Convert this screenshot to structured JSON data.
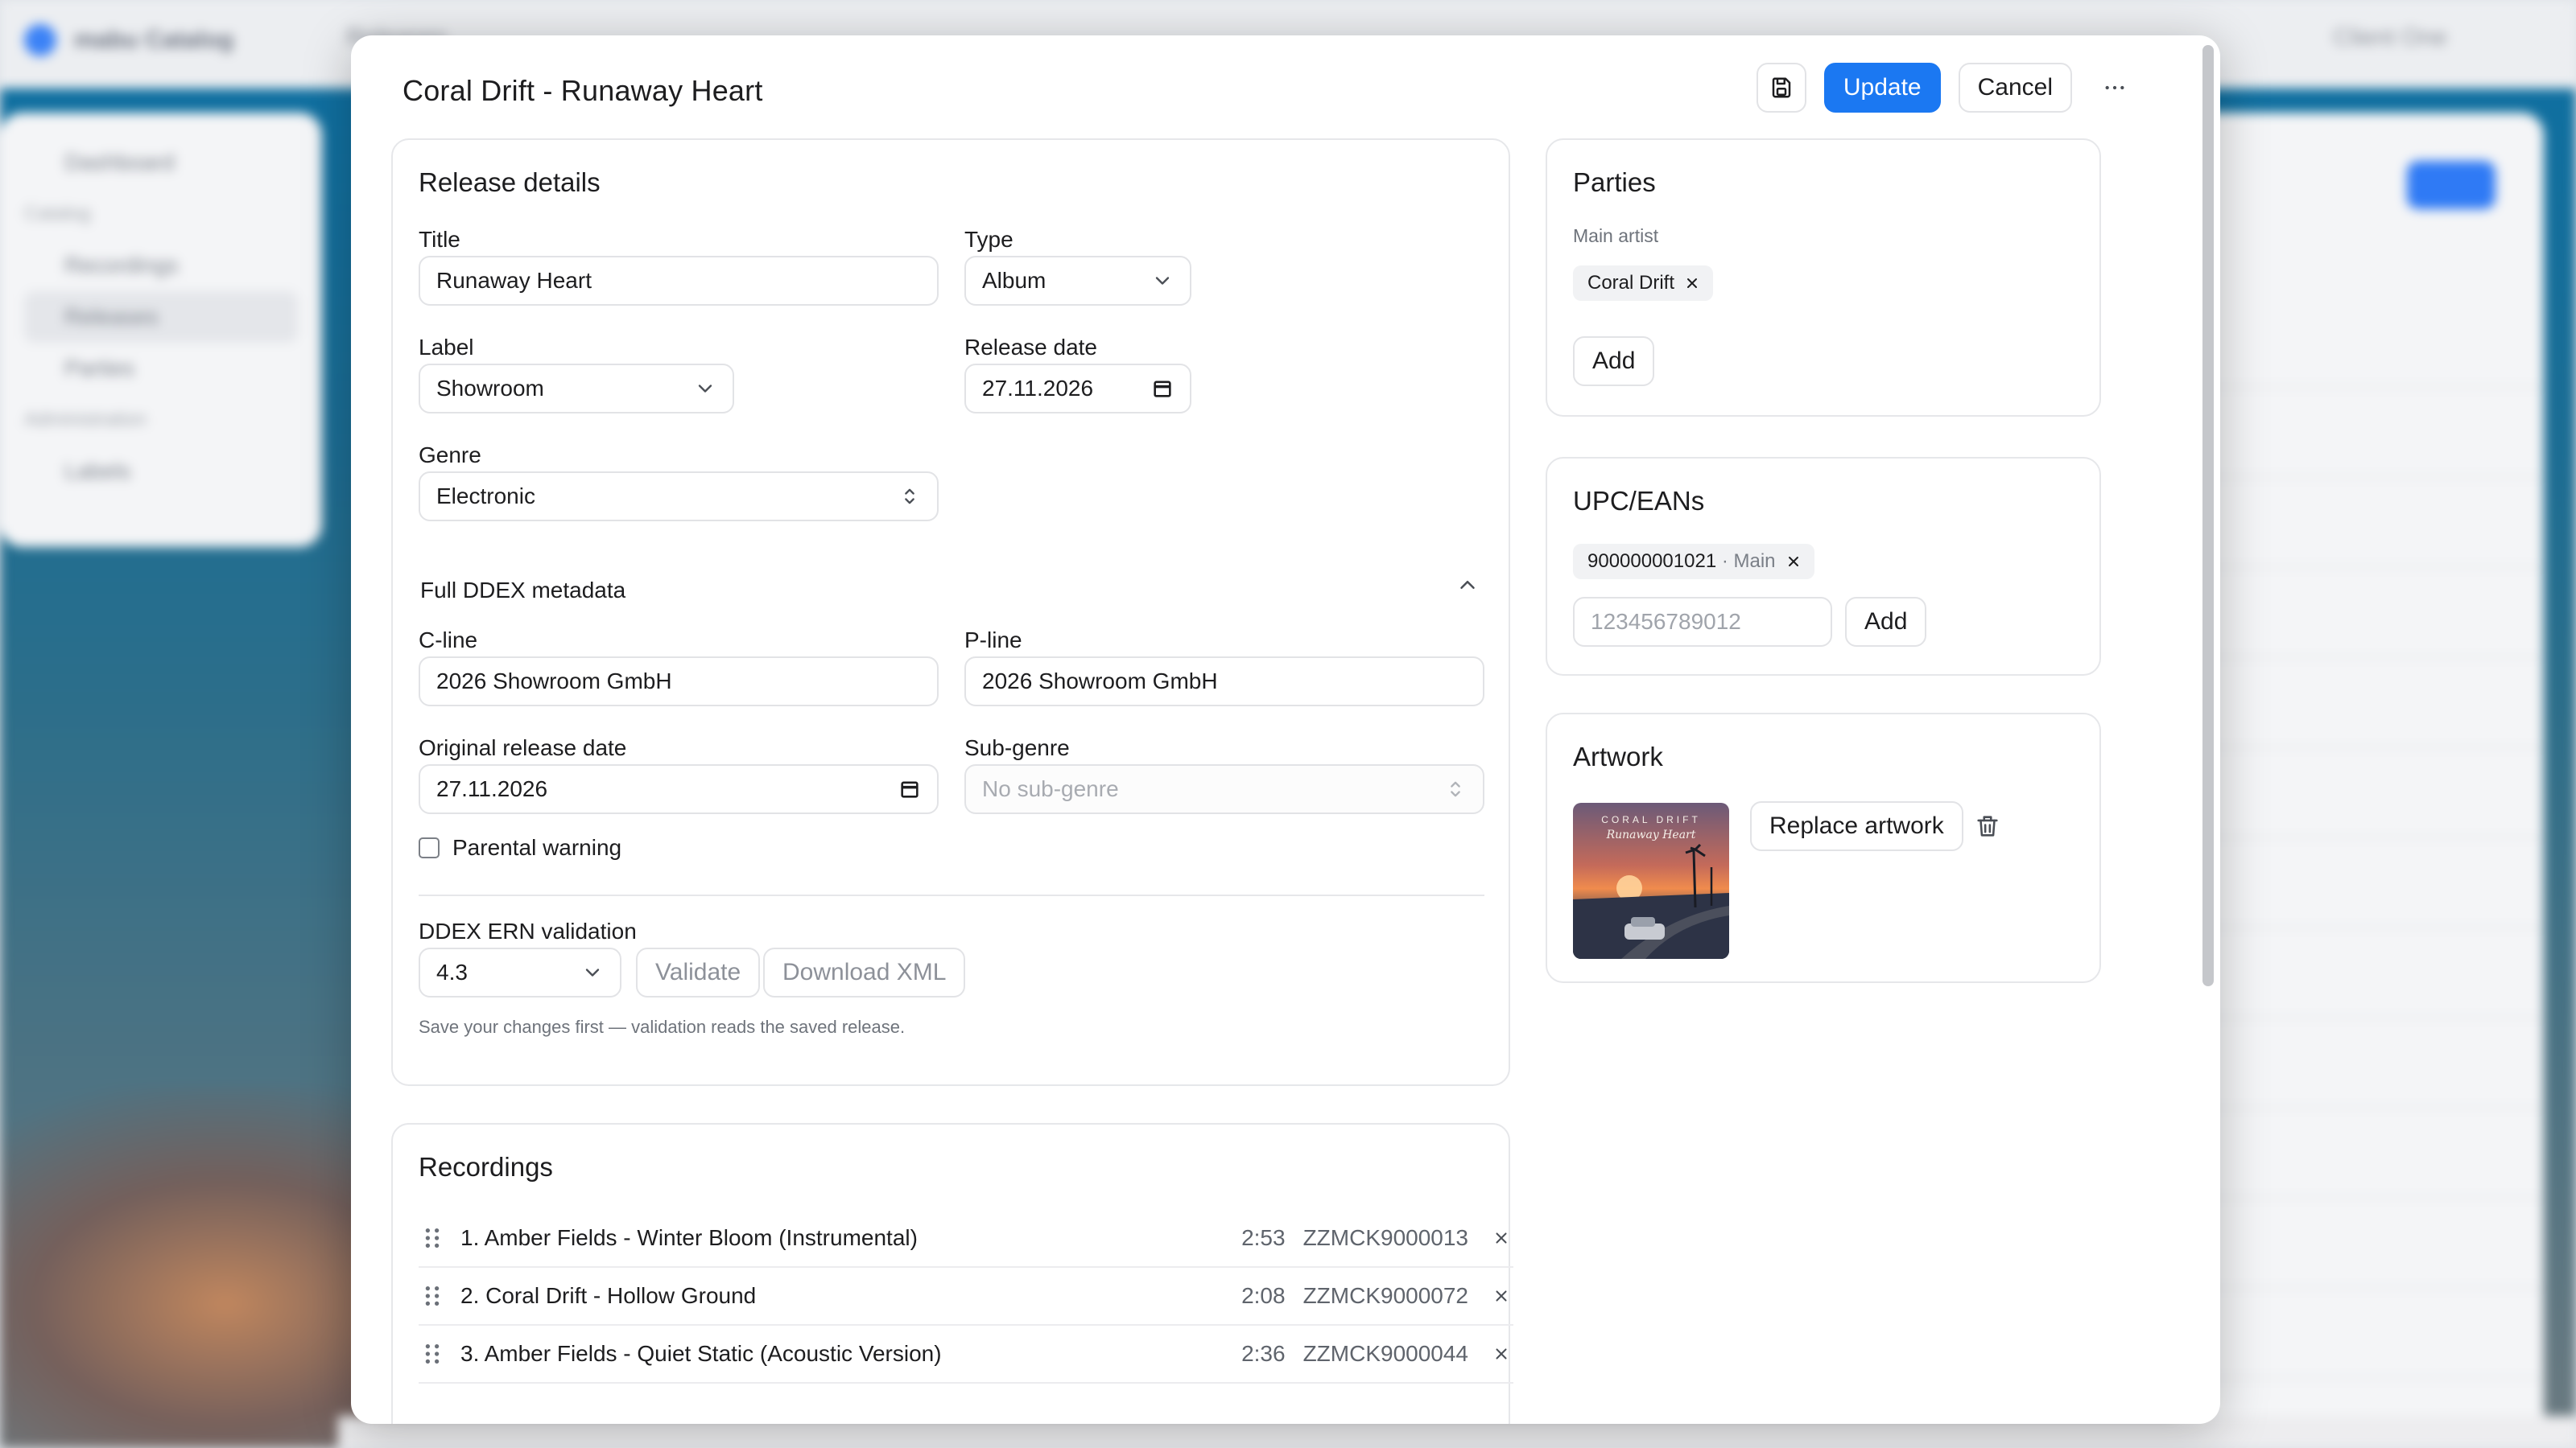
{
  "background": {
    "brand": "mabu Catalog",
    "breadcrumb": "Releases",
    "client": "Client One",
    "sidebar": [
      {
        "label": "Dashboard",
        "type": "item"
      },
      {
        "label": "Catalog",
        "type": "head"
      },
      {
        "label": "Recordings",
        "type": "item"
      },
      {
        "label": "Releases",
        "type": "item",
        "active": true
      },
      {
        "label": "Parties",
        "type": "item"
      },
      {
        "label": "Administration",
        "type": "head"
      },
      {
        "label": "Labels",
        "type": "item"
      }
    ]
  },
  "modal": {
    "title": "Coral Drift - Runaway Heart",
    "actions": {
      "save_icon": "save-icon",
      "update": "Update",
      "cancel": "Cancel",
      "more_icon": "more-horizontal-icon"
    }
  },
  "release_details": {
    "heading": "Release details",
    "title_label": "Title",
    "title_value": "Runaway Heart",
    "type_label": "Type",
    "type_value": "Album",
    "label_label": "Label",
    "label_value": "Showroom",
    "release_date_label": "Release date",
    "release_date_value": "27.11.2026",
    "genre_label": "Genre",
    "genre_value": "Electronic",
    "ddex_heading": "Full DDEX metadata",
    "cline_label": "C-line",
    "cline_value": "2026 Showroom GmbH",
    "pline_label": "P-line",
    "pline_value": "2026 Showroom GmbH",
    "original_release_date_label": "Original release date",
    "original_release_date_value": "27.11.2026",
    "subgenre_label": "Sub-genre",
    "subgenre_placeholder": "No sub-genre",
    "parental_warning_label": "Parental warning",
    "parental_warning_checked": false,
    "ern_heading": "DDEX ERN validation",
    "ern_version": "4.3",
    "validate_label": "Validate",
    "download_xml_label": "Download XML",
    "ern_hint": "Save your changes first — validation reads the saved release."
  },
  "parties": {
    "heading": "Parties",
    "main_artist_label": "Main artist",
    "main_artist": "Coral Drift",
    "add_label": "Add"
  },
  "upc": {
    "heading": "UPC/EANs",
    "code": "900000001021",
    "code_tag": "· Main",
    "input_placeholder": "123456789012",
    "add_label": "Add"
  },
  "artwork": {
    "heading": "Artwork",
    "cover_line1": "CORAL DRIFT",
    "cover_line2": "Runaway Heart",
    "replace_label": "Replace artwork",
    "delete_icon": "trash-icon"
  },
  "recordings": {
    "heading": "Recordings",
    "rows": [
      {
        "title": "1. Amber Fields - Winter Bloom (Instrumental)",
        "duration": "2:53",
        "isrc": "ZZMCK9000013"
      },
      {
        "title": "2. Coral Drift - Hollow Ground",
        "duration": "2:08",
        "isrc": "ZZMCK9000072"
      },
      {
        "title": "3. Amber Fields - Quiet Static (Acoustic Version)",
        "duration": "2:36",
        "isrc": "ZZMCK9000044"
      }
    ]
  }
}
